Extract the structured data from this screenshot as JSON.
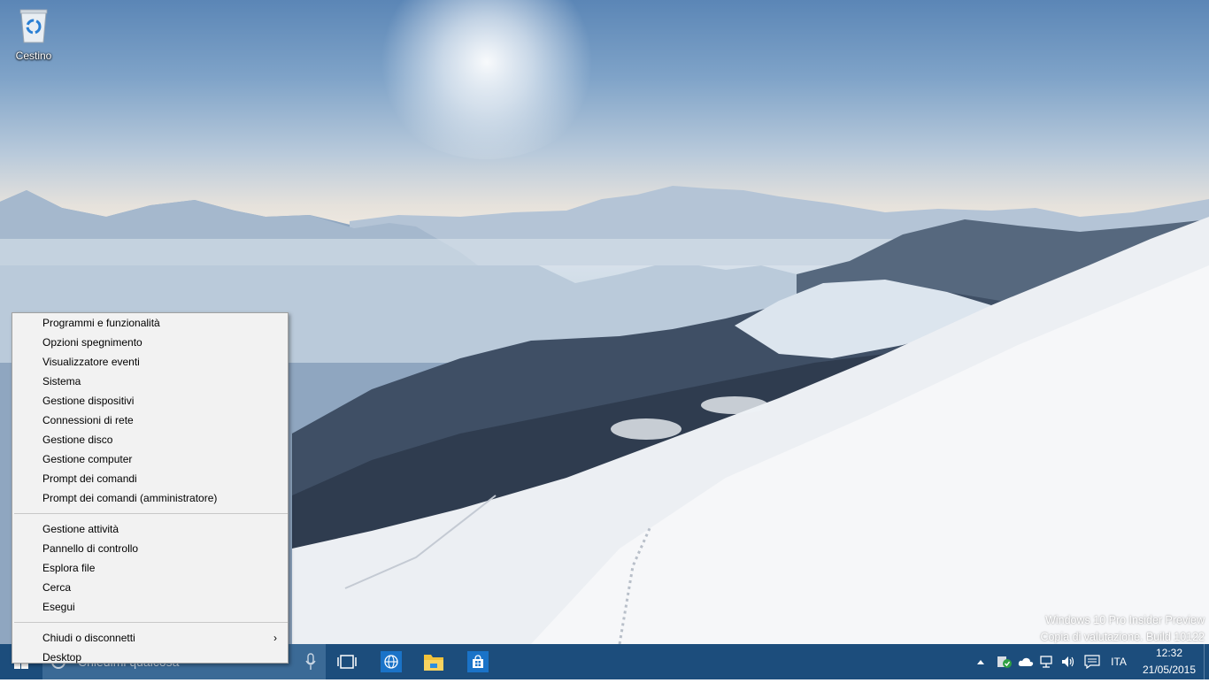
{
  "desktop": {
    "icons": [
      {
        "label": "Cestino",
        "icon": "recycle-bin-icon"
      }
    ],
    "watermark": {
      "line1": "Windows 10 Pro Insider Preview",
      "line2": "Copia di valutazione. Build 10122"
    }
  },
  "context_menu": {
    "group1": [
      {
        "label": "Programmi e funzionalità"
      },
      {
        "label": "Opzioni spegnimento"
      },
      {
        "label": "Visualizzatore eventi"
      },
      {
        "label": "Sistema"
      },
      {
        "label": "Gestione dispositivi"
      },
      {
        "label": "Connessioni di rete"
      },
      {
        "label": "Gestione disco"
      },
      {
        "label": "Gestione computer"
      },
      {
        "label": "Prompt dei comandi"
      },
      {
        "label": "Prompt dei comandi (amministratore)"
      }
    ],
    "group2": [
      {
        "label": "Gestione attività"
      },
      {
        "label": "Pannello di controllo"
      },
      {
        "label": "Esplora file"
      },
      {
        "label": "Cerca"
      },
      {
        "label": "Esegui"
      }
    ],
    "group3": [
      {
        "label": "Chiudi o disconnetti",
        "submenu_arrow": "›"
      },
      {
        "label": "Desktop"
      }
    ]
  },
  "taskbar": {
    "search_placeholder": "Chiedimi qualcosa",
    "pinned": [
      "task-view-icon",
      "globe-icon",
      "file-explorer-icon",
      "store-icon"
    ],
    "tray": {
      "language": "ITA",
      "time": "12:32",
      "date": "21/05/2015"
    }
  },
  "colors": {
    "taskbar": "#1c4d7c",
    "search": "#3b6a96",
    "menu_bg": "#f2f2f2",
    "accent": "#1a73c8"
  }
}
